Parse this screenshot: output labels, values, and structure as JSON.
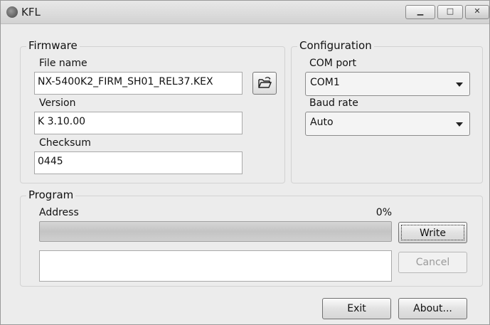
{
  "window": {
    "title": "KFL"
  },
  "firmware": {
    "group_label": "Firmware",
    "file_name_label": "File name",
    "file_name_value": "NX-5400K2_FIRM_SH01_REL37.KEX",
    "version_label": "Version",
    "version_value": "K 3.10.00",
    "checksum_label": "Checksum",
    "checksum_value": "0445",
    "browse_icon": "open-folder-icon"
  },
  "configuration": {
    "group_label": "Configuration",
    "com_port_label": "COM port",
    "com_port_value": "COM1",
    "baud_rate_label": "Baud rate",
    "baud_rate_value": "Auto"
  },
  "program": {
    "group_label": "Program",
    "status_label": "Address",
    "percent_text": "0%",
    "progress": 0,
    "log_text": "",
    "write_label": "Write",
    "cancel_label": "Cancel"
  },
  "footer": {
    "exit_label": "Exit",
    "about_label": "About..."
  }
}
